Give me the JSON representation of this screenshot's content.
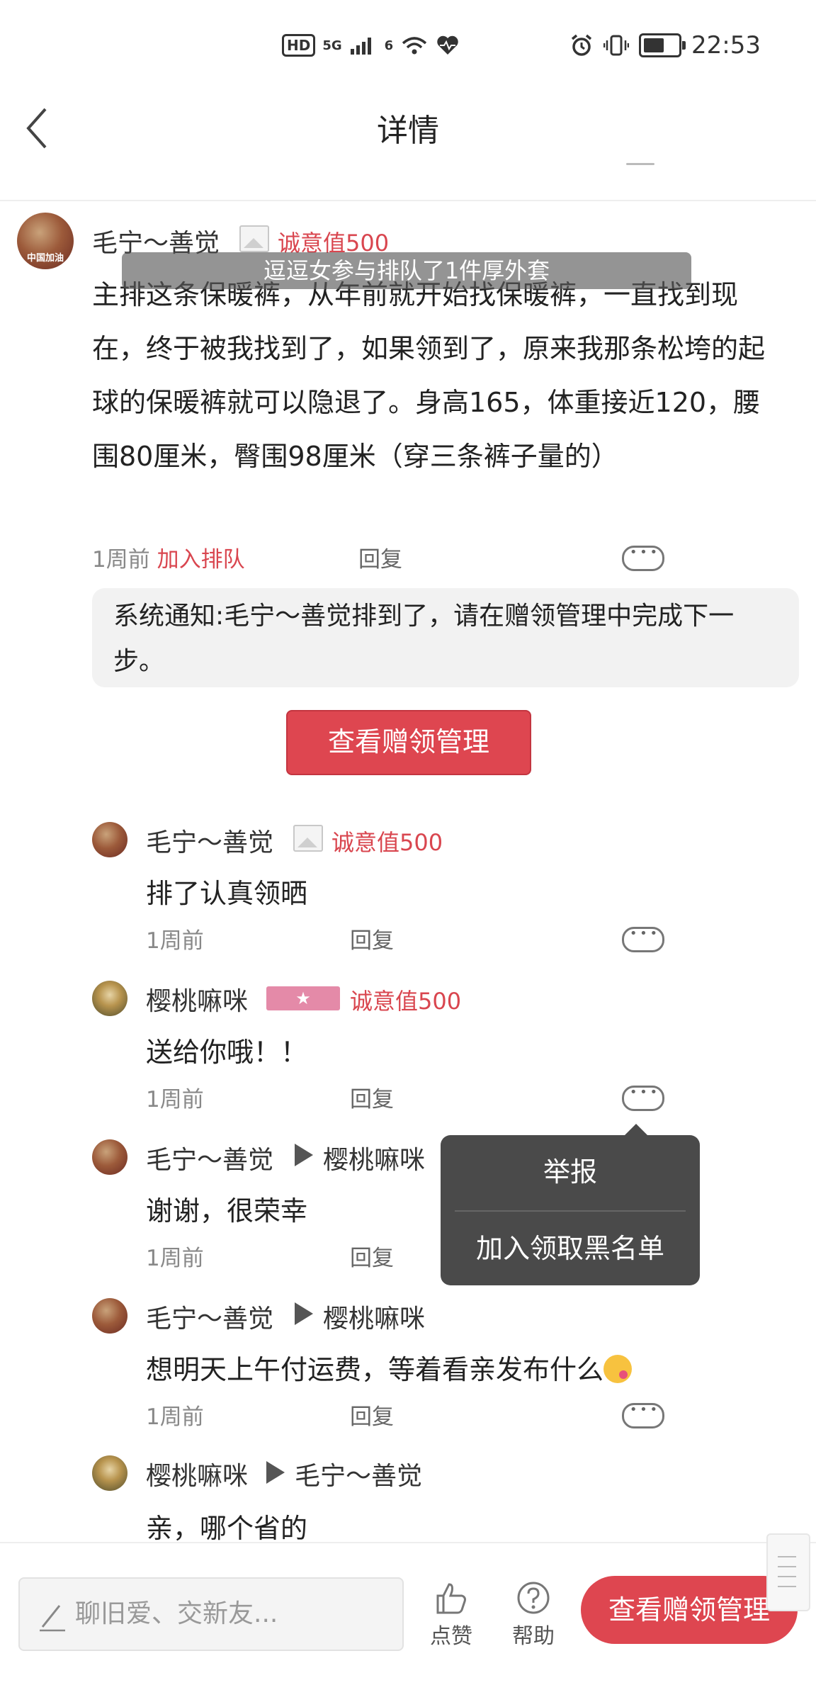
{
  "status_bar": {
    "network_badge": "HD",
    "signal": "5G",
    "wifi_sub": "6",
    "time": "22:53",
    "battery_level_percent": 60
  },
  "header": {
    "title": "详情"
  },
  "toast": "逗逗女参与排队了1件厚外套",
  "post": {
    "username": "毛宁～善觉",
    "score": "诚意值500",
    "avatar_text": "中国加油",
    "content": "主排这条保暖裤，从年前就开始找保暖裤，一直找到现在，终于被我找到了，如果领到了，原来我那条松垮的起球的保暖裤就可以隐退了。身高165，体重接近120，腰围80厘米，臀围98厘米（穿三条裤子量的）",
    "time": "1周前",
    "join_queue": "加入排队",
    "reply": "回复"
  },
  "notice": {
    "text": "系统通知:毛宁～善觉排到了，请在赠领管理中完成下一步。",
    "button": "查看赠领管理"
  },
  "replies": [
    {
      "user": "毛宁～善觉",
      "score": "诚意值500",
      "text": "排了认真领晒",
      "time": "1周前",
      "reply": "回复"
    },
    {
      "user": "樱桃嘛咪",
      "score": "诚意值500",
      "badge": "★",
      "text": "送给你哦！！",
      "time": "1周前",
      "reply": "回复"
    },
    {
      "user": "毛宁～善觉",
      "to": "樱桃嘛咪",
      "text": "谢谢，很荣幸",
      "time": "1周前",
      "reply": "回复"
    },
    {
      "user": "毛宁～善觉",
      "to": "樱桃嘛咪",
      "text": "想明天上午付运费，等着看亲发布什么",
      "time": "1周前",
      "reply": "回复"
    },
    {
      "user": "樱桃嘛咪",
      "to": "毛宁～善觉",
      "text": "亲，哪个省的"
    }
  ],
  "popup_menu": {
    "items": [
      "举报",
      "加入领取黑名单"
    ]
  },
  "bottom_bar": {
    "input_placeholder": "聊旧爱、交新友...",
    "like": "点赞",
    "help": "帮助",
    "button": "查看赠领管理"
  }
}
